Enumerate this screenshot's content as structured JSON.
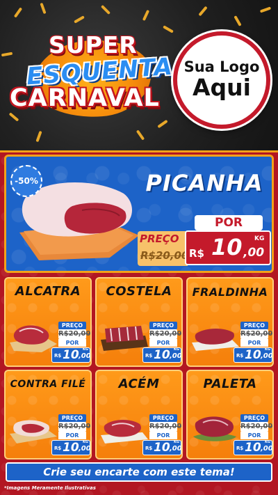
{
  "header": {
    "title_lines": [
      "SUPER",
      "ESQUENTA",
      "CARNAVAL"
    ],
    "logo_line1": "Sua Logo",
    "logo_line2": "Aqui"
  },
  "hero": {
    "discount": "-50%",
    "name": "PICANHA",
    "por_label": "POR",
    "preco_label": "PREÇO",
    "old_price": "R$20,00",
    "unit": "KG",
    "currency": "R$",
    "price_int": "10",
    "price_dec": ",00"
  },
  "products": [
    {
      "name": "ALCATRA",
      "preco_label": "PREÇO",
      "old_price": "R$20,00",
      "por_label": "POR",
      "currency": "R$",
      "price_int": "10",
      "price_dec": ",00",
      "unit": "KG"
    },
    {
      "name": "COSTELA",
      "preco_label": "PREÇO",
      "old_price": "R$20,00",
      "por_label": "POR",
      "currency": "R$",
      "price_int": "10",
      "price_dec": ",00",
      "unit": "KG"
    },
    {
      "name": "FRALDINHA",
      "preco_label": "PREÇO",
      "old_price": "R$20,00",
      "por_label": "POR",
      "currency": "R$",
      "price_int": "10",
      "price_dec": ",00",
      "unit": "KG"
    },
    {
      "name": "CONTRA FILÉ",
      "preco_label": "PREÇO",
      "old_price": "R$20,00",
      "por_label": "POR",
      "currency": "R$",
      "price_int": "10",
      "price_dec": ",00",
      "unit": "KG"
    },
    {
      "name": "ACÉM",
      "preco_label": "PREÇO",
      "old_price": "R$20,00",
      "por_label": "POR",
      "currency": "R$",
      "price_int": "10",
      "price_dec": ",00",
      "unit": "KG"
    },
    {
      "name": "PALETA",
      "preco_label": "PREÇO",
      "old_price": "R$20,00",
      "por_label": "POR",
      "currency": "R$",
      "price_int": "10",
      "price_dec": ",00",
      "unit": "KG"
    }
  ],
  "footer": {
    "cta": "Crie seu encarte com este tema!",
    "disclaimer": "*Imagens Meramente Ilustrativas"
  },
  "colors": {
    "background_red": "#b21622",
    "hero_blue": "#1d63c8",
    "card_orange": "#f58a0b",
    "accent_gold": "#f3a11a",
    "price_red": "#c41a2b"
  },
  "icons": [
    "confetti-decoration",
    "meat-cut-image",
    "discount-seal"
  ]
}
